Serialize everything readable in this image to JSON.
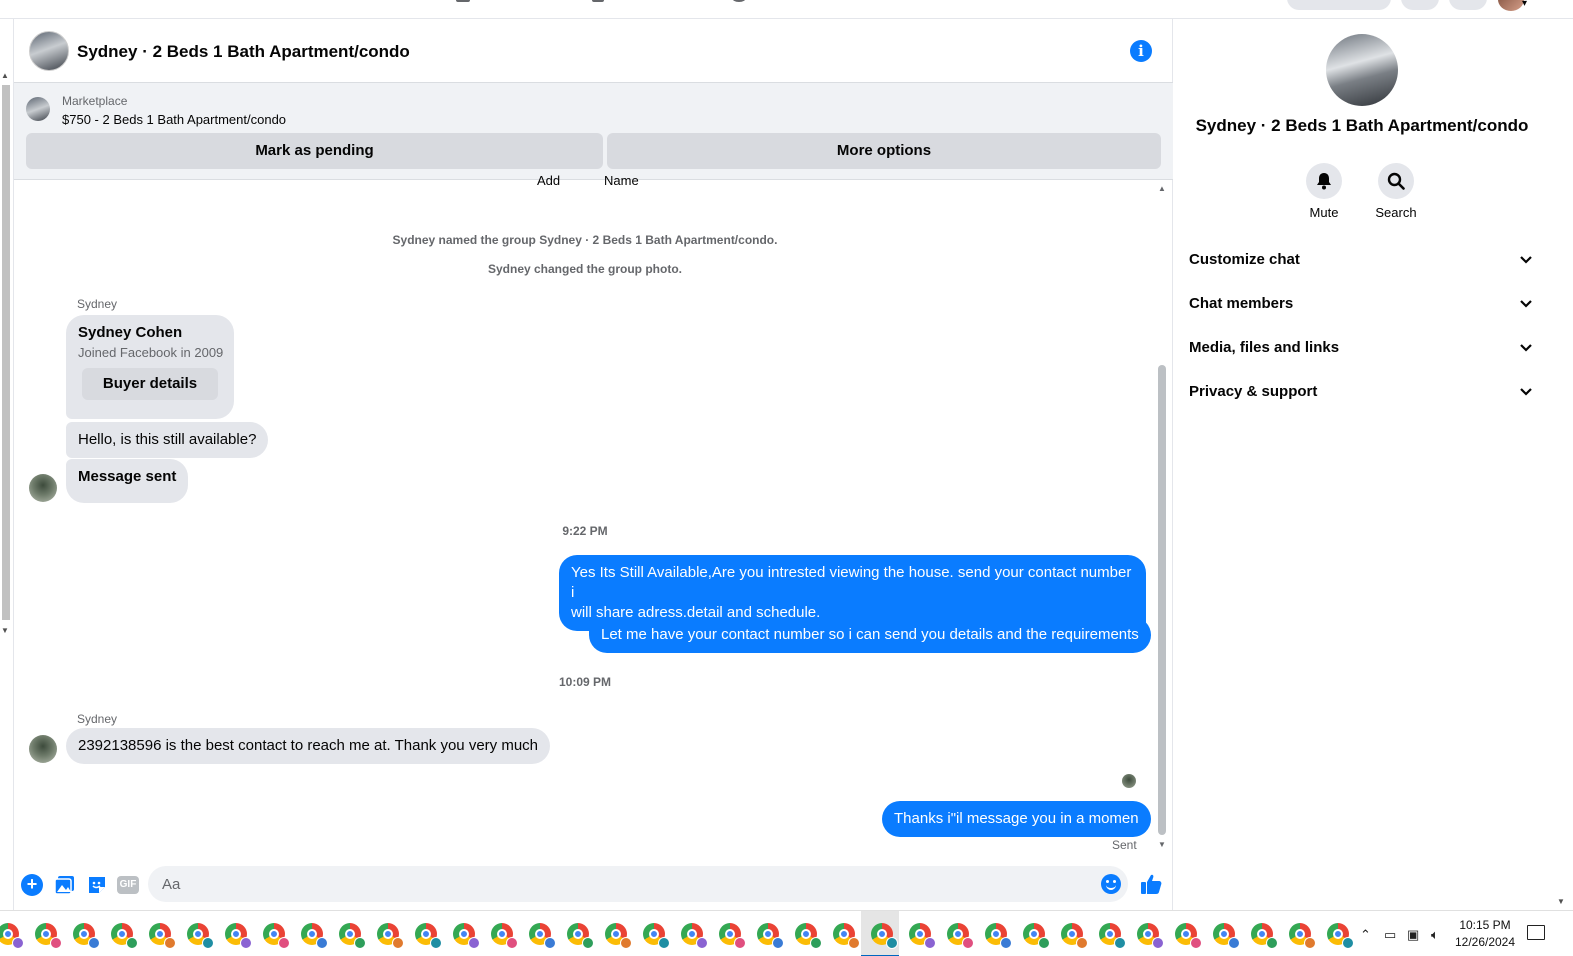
{
  "header": {
    "title": "Sydney · 2 Beds 1 Bath Apartment/condo"
  },
  "marketplace": {
    "label": "Marketplace",
    "listing": "$750 - 2 Beds 1 Bath Apartment/condo",
    "mark_pending_label": "Mark as pending",
    "more_options_label": "More options"
  },
  "cut_off_labels": [
    "Add",
    "Name"
  ],
  "system_messages": [
    "Sydney named the group Sydney · 2 Beds 1 Bath Apartment/condo.",
    "Sydney changed the group photo."
  ],
  "buyer_card": {
    "sender": "Sydney",
    "name": "Sydney Cohen",
    "joined": "Joined Facebook in 2009",
    "button_label": "Buyer details"
  },
  "messages": {
    "in_1": "Hello, is this still available?",
    "in_2": "Message sent",
    "time_1": "9:22 PM",
    "out_1_line1": "Yes Its Still Available,Are you intrested viewing the house. send your contact number i",
    "out_1_line2": "will share adress,detail and schedule.",
    "out_2": "Let me have your contact number so i can send you details and the requirements",
    "time_2": "10:09 PM",
    "sender_2": "Sydney",
    "in_3": "2392138596 is the best contact to reach me at. Thank you very much",
    "out_3": "Thanks i\"il message you in a momen",
    "status": "Sent"
  },
  "composer": {
    "placeholder": "Aa",
    "gif_label": "GIF",
    "plus_label": "+"
  },
  "info_panel": {
    "title": "Sydney · 2 Beds 1 Bath Apartment/condo",
    "actions": [
      {
        "label": "Mute",
        "icon": "bell-icon"
      },
      {
        "label": "Search",
        "icon": "search-icon"
      }
    ],
    "sections": [
      "Customize chat",
      "Chat members",
      "Media, files and links",
      "Privacy & support"
    ]
  },
  "taskbar": {
    "time": "10:15 PM",
    "date": "12/26/2024"
  },
  "colors": {
    "accent": "#0a7cff",
    "bubble_in": "#e4e6eb",
    "button_gray": "#d8dadf",
    "panel_bg": "#f0f2f5",
    "secondary_text": "#65676b"
  }
}
